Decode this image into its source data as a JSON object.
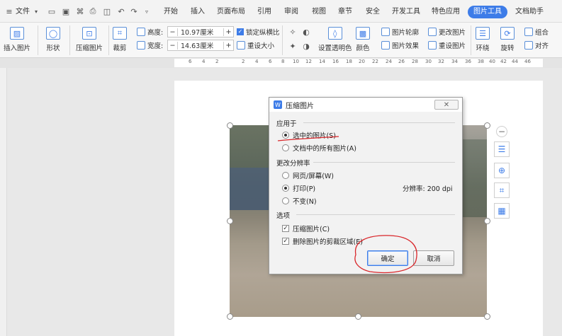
{
  "menubar": {
    "menu_icon": "hamburger-icon",
    "file_label": "文件",
    "tabs": [
      "开始",
      "插入",
      "页面布局",
      "引用",
      "审阅",
      "视图",
      "章节",
      "安全",
      "开发工具",
      "特色应用",
      "图片工具",
      "文档助手"
    ],
    "active_tab": "图片工具"
  },
  "ribbon": {
    "insert_picture": "插入图片",
    "shape": "形状",
    "compress_picture": "压缩图片",
    "crop": "裁剪",
    "height_label": "高度:",
    "height_value": "10.97厘米",
    "width_label": "宽度:",
    "width_value": "14.63厘米",
    "lock_ratio": "锁定纵横比",
    "reset_size": "重设大小",
    "set_transparent": "设置透明色",
    "color": "颜色",
    "outline": "图片轮廓",
    "effects": "图片效果",
    "change_picture": "更改图片",
    "reset_picture": "重设图片",
    "wrap": "环绕",
    "rotate": "旋转",
    "group": "组合",
    "align": "对齐",
    "minus": "−",
    "plus": "+"
  },
  "ruler": {
    "numbers": [
      "6",
      "4",
      "2",
      "2",
      "4",
      "6",
      "8",
      "10",
      "12",
      "14",
      "16",
      "18",
      "20",
      "22",
      "24",
      "26",
      "28",
      "30",
      "32",
      "34",
      "36",
      "38",
      "40",
      "42",
      "44",
      "46"
    ]
  },
  "dialog": {
    "title": "压缩图片",
    "close": "✕",
    "apply_to_label": "应用于",
    "apply_options": [
      "选中的图片(S)",
      "文档中的所有图片(A)"
    ],
    "resolution_label": "更改分辨率",
    "resolution_options": [
      "网页/屏幕(W)",
      "打印(P)",
      "不变(N)"
    ],
    "resolution_value": "分辨率: 200 dpi",
    "options_label": "选项",
    "options": [
      "压缩图片(C)",
      "删除图片的剪裁区域(E)"
    ],
    "ok_label": "确定",
    "cancel_label": "取消"
  },
  "colors": {
    "accent": "#3d7ce8",
    "annotation_red": "#d9262a"
  }
}
